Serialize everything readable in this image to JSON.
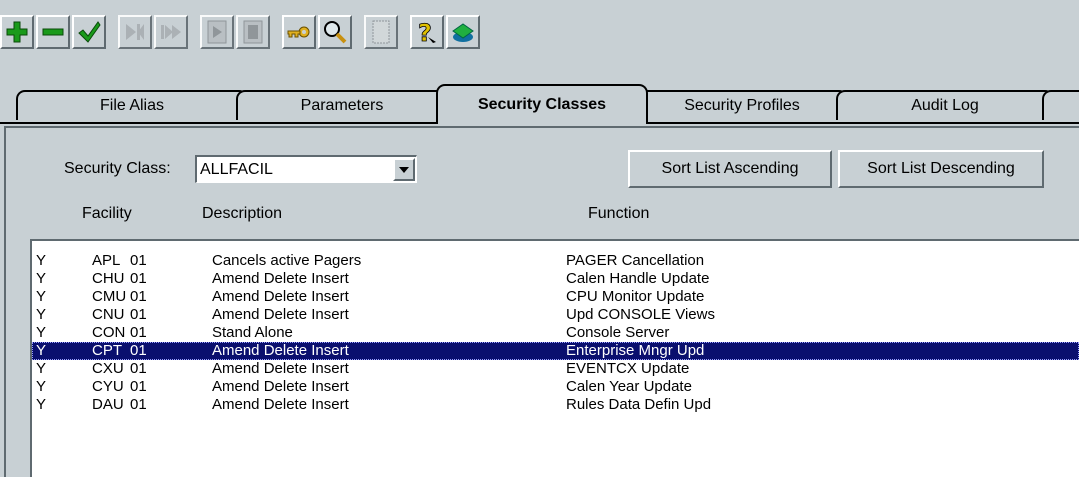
{
  "toolbar": {
    "buttons": [
      {
        "name": "add-icon",
        "enabled": true
      },
      {
        "name": "remove-icon",
        "enabled": true
      },
      {
        "name": "check-icon",
        "enabled": true
      },
      {
        "name": "skip-end-icon",
        "enabled": false
      },
      {
        "name": "fast-forward-icon",
        "enabled": false
      },
      {
        "name": "document-play-icon",
        "enabled": false
      },
      {
        "name": "document-icon",
        "enabled": false
      },
      {
        "name": "key-icon",
        "enabled": true
      },
      {
        "name": "magnifier-icon",
        "enabled": true
      },
      {
        "name": "page-icon",
        "enabled": false
      },
      {
        "name": "help-icon",
        "enabled": true
      },
      {
        "name": "database-icon",
        "enabled": true
      }
    ]
  },
  "tabs": [
    {
      "label": "File Alias",
      "active": false
    },
    {
      "label": "Parameters",
      "active": false
    },
    {
      "label": "Security Classes",
      "active": true
    },
    {
      "label": "Security Profiles",
      "active": false
    },
    {
      "label": "Audit Log",
      "active": false
    }
  ],
  "security_class": {
    "label": "Security Class:",
    "value": "ALLFACIL"
  },
  "buttons": {
    "sort_asc": "Sort List Ascending",
    "sort_desc": "Sort List Descending"
  },
  "columns": {
    "facility": "Facility",
    "description": "Description",
    "function": "Function"
  },
  "rows": [
    {
      "flag": "Y",
      "code": "APL",
      "num": "01",
      "description": "Cancels active Pagers",
      "function": "PAGER Cancellation",
      "selected": false
    },
    {
      "flag": "Y",
      "code": "CHU",
      "num": "01",
      "description": "Amend Delete Insert",
      "function": "Calen Handle Update",
      "selected": false
    },
    {
      "flag": "Y",
      "code": "CMU",
      "num": "01",
      "description": "Amend Delete Insert",
      "function": "CPU Monitor Update",
      "selected": false
    },
    {
      "flag": "Y",
      "code": "CNU",
      "num": "01",
      "description": "Amend Delete Insert",
      "function": "Upd CONSOLE Views",
      "selected": false
    },
    {
      "flag": "Y",
      "code": "CON",
      "num": "01",
      "description": "Stand Alone",
      "function": "Console Server",
      "selected": false
    },
    {
      "flag": "Y",
      "code": "CPT",
      "num": "01",
      "description": "Amend Delete Insert",
      "function": "Enterprise Mngr Upd",
      "selected": true
    },
    {
      "flag": "Y",
      "code": "CXU",
      "num": "01",
      "description": "Amend Delete Insert",
      "function": "EVENTCX Update",
      "selected": false
    },
    {
      "flag": "Y",
      "code": "CYU",
      "num": "01",
      "description": "Amend Delete Insert",
      "function": "Calen Year Update",
      "selected": false
    },
    {
      "flag": "Y",
      "code": "DAU",
      "num": "01",
      "description": "Amend Delete Insert",
      "function": "Rules Data Defin Upd",
      "selected": false
    }
  ]
}
